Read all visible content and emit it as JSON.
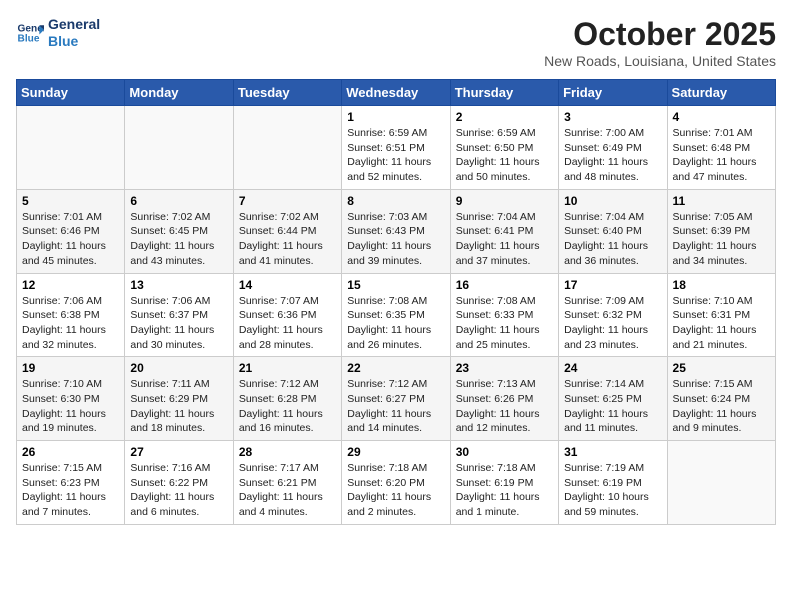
{
  "header": {
    "logo_line1": "General",
    "logo_line2": "Blue",
    "month": "October 2025",
    "location": "New Roads, Louisiana, United States"
  },
  "weekdays": [
    "Sunday",
    "Monday",
    "Tuesday",
    "Wednesday",
    "Thursday",
    "Friday",
    "Saturday"
  ],
  "weeks": [
    [
      {
        "day": "",
        "info": ""
      },
      {
        "day": "",
        "info": ""
      },
      {
        "day": "",
        "info": ""
      },
      {
        "day": "1",
        "info": "Sunrise: 6:59 AM\nSunset: 6:51 PM\nDaylight: 11 hours and 52 minutes."
      },
      {
        "day": "2",
        "info": "Sunrise: 6:59 AM\nSunset: 6:50 PM\nDaylight: 11 hours and 50 minutes."
      },
      {
        "day": "3",
        "info": "Sunrise: 7:00 AM\nSunset: 6:49 PM\nDaylight: 11 hours and 48 minutes."
      },
      {
        "day": "4",
        "info": "Sunrise: 7:01 AM\nSunset: 6:48 PM\nDaylight: 11 hours and 47 minutes."
      }
    ],
    [
      {
        "day": "5",
        "info": "Sunrise: 7:01 AM\nSunset: 6:46 PM\nDaylight: 11 hours and 45 minutes."
      },
      {
        "day": "6",
        "info": "Sunrise: 7:02 AM\nSunset: 6:45 PM\nDaylight: 11 hours and 43 minutes."
      },
      {
        "day": "7",
        "info": "Sunrise: 7:02 AM\nSunset: 6:44 PM\nDaylight: 11 hours and 41 minutes."
      },
      {
        "day": "8",
        "info": "Sunrise: 7:03 AM\nSunset: 6:43 PM\nDaylight: 11 hours and 39 minutes."
      },
      {
        "day": "9",
        "info": "Sunrise: 7:04 AM\nSunset: 6:41 PM\nDaylight: 11 hours and 37 minutes."
      },
      {
        "day": "10",
        "info": "Sunrise: 7:04 AM\nSunset: 6:40 PM\nDaylight: 11 hours and 36 minutes."
      },
      {
        "day": "11",
        "info": "Sunrise: 7:05 AM\nSunset: 6:39 PM\nDaylight: 11 hours and 34 minutes."
      }
    ],
    [
      {
        "day": "12",
        "info": "Sunrise: 7:06 AM\nSunset: 6:38 PM\nDaylight: 11 hours and 32 minutes."
      },
      {
        "day": "13",
        "info": "Sunrise: 7:06 AM\nSunset: 6:37 PM\nDaylight: 11 hours and 30 minutes."
      },
      {
        "day": "14",
        "info": "Sunrise: 7:07 AM\nSunset: 6:36 PM\nDaylight: 11 hours and 28 minutes."
      },
      {
        "day": "15",
        "info": "Sunrise: 7:08 AM\nSunset: 6:35 PM\nDaylight: 11 hours and 26 minutes."
      },
      {
        "day": "16",
        "info": "Sunrise: 7:08 AM\nSunset: 6:33 PM\nDaylight: 11 hours and 25 minutes."
      },
      {
        "day": "17",
        "info": "Sunrise: 7:09 AM\nSunset: 6:32 PM\nDaylight: 11 hours and 23 minutes."
      },
      {
        "day": "18",
        "info": "Sunrise: 7:10 AM\nSunset: 6:31 PM\nDaylight: 11 hours and 21 minutes."
      }
    ],
    [
      {
        "day": "19",
        "info": "Sunrise: 7:10 AM\nSunset: 6:30 PM\nDaylight: 11 hours and 19 minutes."
      },
      {
        "day": "20",
        "info": "Sunrise: 7:11 AM\nSunset: 6:29 PM\nDaylight: 11 hours and 18 minutes."
      },
      {
        "day": "21",
        "info": "Sunrise: 7:12 AM\nSunset: 6:28 PM\nDaylight: 11 hours and 16 minutes."
      },
      {
        "day": "22",
        "info": "Sunrise: 7:12 AM\nSunset: 6:27 PM\nDaylight: 11 hours and 14 minutes."
      },
      {
        "day": "23",
        "info": "Sunrise: 7:13 AM\nSunset: 6:26 PM\nDaylight: 11 hours and 12 minutes."
      },
      {
        "day": "24",
        "info": "Sunrise: 7:14 AM\nSunset: 6:25 PM\nDaylight: 11 hours and 11 minutes."
      },
      {
        "day": "25",
        "info": "Sunrise: 7:15 AM\nSunset: 6:24 PM\nDaylight: 11 hours and 9 minutes."
      }
    ],
    [
      {
        "day": "26",
        "info": "Sunrise: 7:15 AM\nSunset: 6:23 PM\nDaylight: 11 hours and 7 minutes."
      },
      {
        "day": "27",
        "info": "Sunrise: 7:16 AM\nSunset: 6:22 PM\nDaylight: 11 hours and 6 minutes."
      },
      {
        "day": "28",
        "info": "Sunrise: 7:17 AM\nSunset: 6:21 PM\nDaylight: 11 hours and 4 minutes."
      },
      {
        "day": "29",
        "info": "Sunrise: 7:18 AM\nSunset: 6:20 PM\nDaylight: 11 hours and 2 minutes."
      },
      {
        "day": "30",
        "info": "Sunrise: 7:18 AM\nSunset: 6:19 PM\nDaylight: 11 hours and 1 minute."
      },
      {
        "day": "31",
        "info": "Sunrise: 7:19 AM\nSunset: 6:19 PM\nDaylight: 10 hours and 59 minutes."
      },
      {
        "day": "",
        "info": ""
      }
    ]
  ]
}
